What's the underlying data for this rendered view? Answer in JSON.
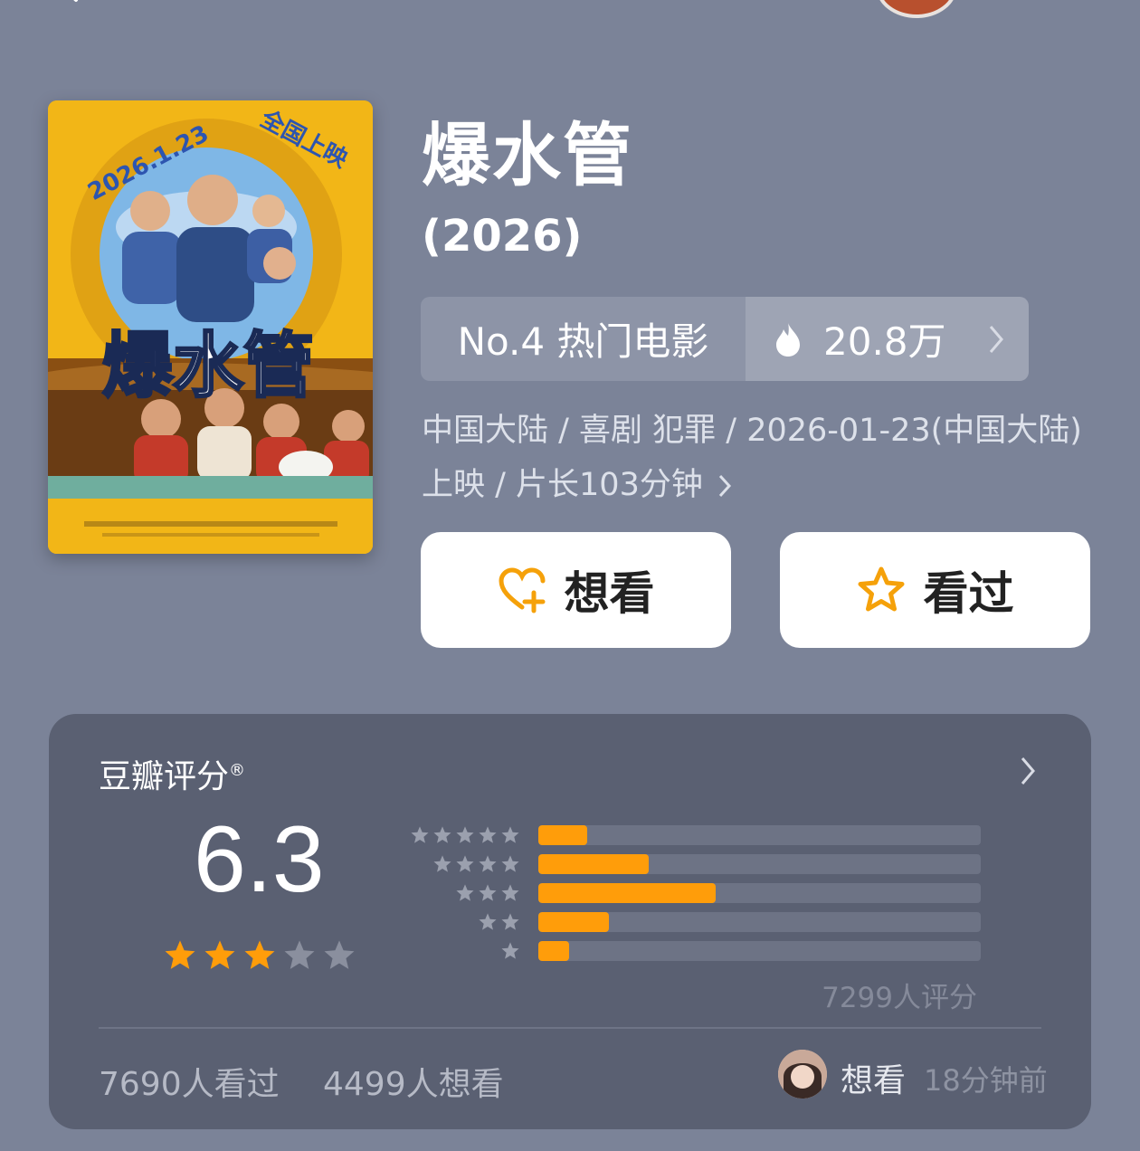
{
  "header": {
    "back_icon": "back-icon"
  },
  "movie": {
    "title": "爆水管",
    "year": "(2026)",
    "poster": {
      "release_date_text": "2026.1.23",
      "release_text": "全国上映",
      "logo_text": "爆水管"
    },
    "rank_label": "No.4 热门电影",
    "heat_value": "20.8万",
    "meta": "中国大陆 / 喜剧 犯罪 / 2026-01-23(中国大陆)上映 / 片长103分钟"
  },
  "actions": {
    "want_label": "想看",
    "seen_label": "看过"
  },
  "rating": {
    "section_title": "豆瓣评分",
    "registered_mark": "®",
    "score": "6.3",
    "stars_filled": 3,
    "stars_total": 5,
    "distribution": [
      {
        "stars": 5,
        "fraction": 0.11
      },
      {
        "stars": 4,
        "fraction": 0.25
      },
      {
        "stars": 3,
        "fraction": 0.4
      },
      {
        "stars": 2,
        "fraction": 0.16
      },
      {
        "stars": 1,
        "fraction": 0.07
      }
    ],
    "count_text": "7299人评分",
    "seen_count_text": "7690人看过",
    "want_count_text": "4499人想看",
    "friend_action": "想看",
    "friend_time": "18分钟前"
  },
  "colors": {
    "background": "#7b8398",
    "card": "#5a6072",
    "accent": "#ff9d0a",
    "poster": "#f2b617"
  }
}
